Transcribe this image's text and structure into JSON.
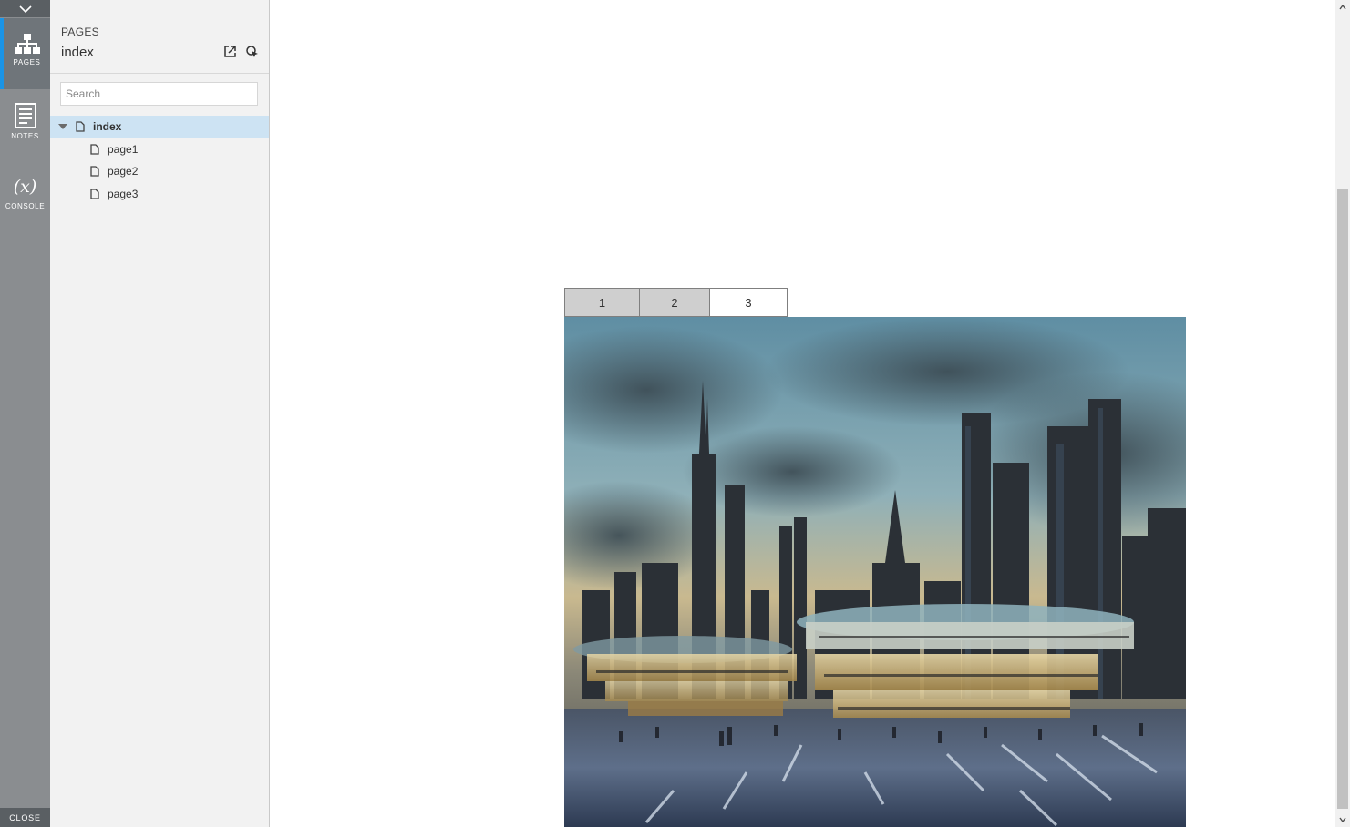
{
  "rail": {
    "items": [
      {
        "label": "PAGES",
        "icon": "sitemap-icon"
      },
      {
        "label": "NOTES",
        "icon": "notes-icon"
      },
      {
        "label": "CONSOLE",
        "icon": "variable-x-icon"
      }
    ],
    "close_label": "CLOSE",
    "accent_color": "#1a94e6"
  },
  "panel": {
    "heading": "PAGES",
    "title": "index",
    "actions": [
      "export-icon",
      "locate-icon"
    ],
    "search_placeholder": "Search",
    "tree": [
      {
        "label": "index",
        "expanded": true,
        "selected": true
      },
      {
        "label": "page1"
      },
      {
        "label": "page2"
      },
      {
        "label": "page3"
      }
    ]
  },
  "content": {
    "tabs": [
      {
        "label": "1",
        "active": false
      },
      {
        "label": "2",
        "active": false
      },
      {
        "label": "3",
        "active": true
      }
    ],
    "image": "city-skyline-photo"
  }
}
